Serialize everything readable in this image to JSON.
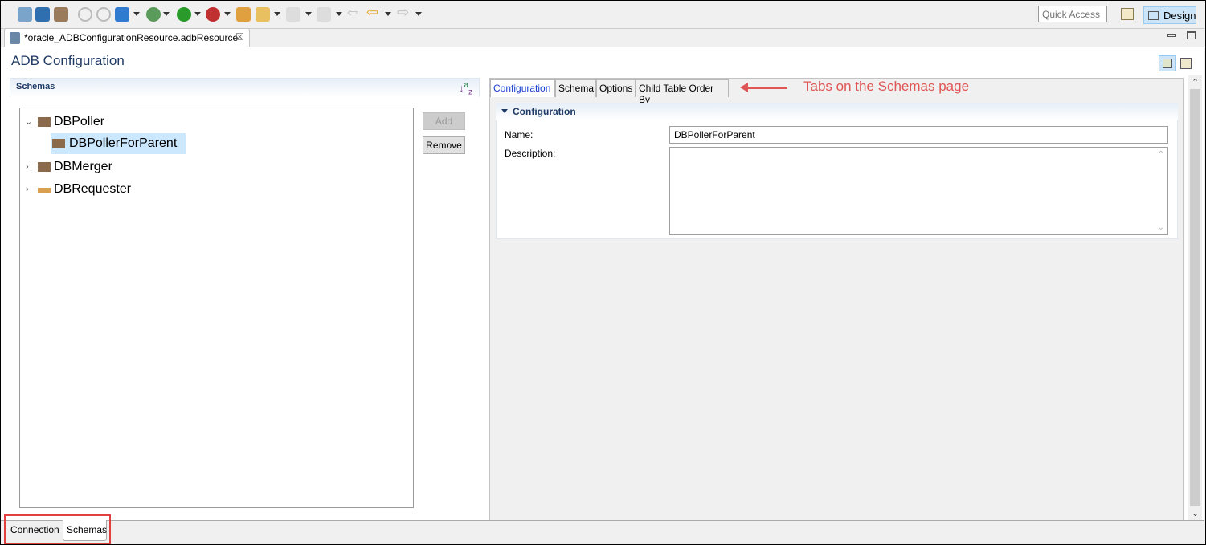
{
  "toolbar": {
    "quick_access_placeholder": "Quick Access",
    "design_label": "Design"
  },
  "editor_tab": {
    "label": "*oracle_ADBConfigurationResource.adbResource"
  },
  "page": {
    "title": "ADB Configuration"
  },
  "schemas": {
    "header": "Schemas",
    "tree": [
      {
        "label": "DBPoller",
        "expanded": true,
        "children": [
          {
            "label": "DBPollerForParent",
            "selected": true
          }
        ]
      },
      {
        "label": "DBMerger",
        "expanded": false
      },
      {
        "label": "DBRequester",
        "expanded": false
      }
    ],
    "add_label": "Add",
    "remove_label": "Remove"
  },
  "detail": {
    "tabs": [
      {
        "label": "Configuration",
        "active": true
      },
      {
        "label": "Schema"
      },
      {
        "label": "Options"
      },
      {
        "label": "Child Table Order By"
      }
    ],
    "section_title": "Configuration",
    "name_label": "Name:",
    "name_value": "DBPollerForParent",
    "description_label": "Description:",
    "description_value": ""
  },
  "annotation": "Tabs on the Schemas page",
  "bottom_tabs": [
    {
      "label": "Connection"
    },
    {
      "label": "Schemas",
      "active": true
    }
  ],
  "colors": {
    "accent": "#1f3a64",
    "annotation": "#e05555",
    "selection": "#cce8ff"
  }
}
